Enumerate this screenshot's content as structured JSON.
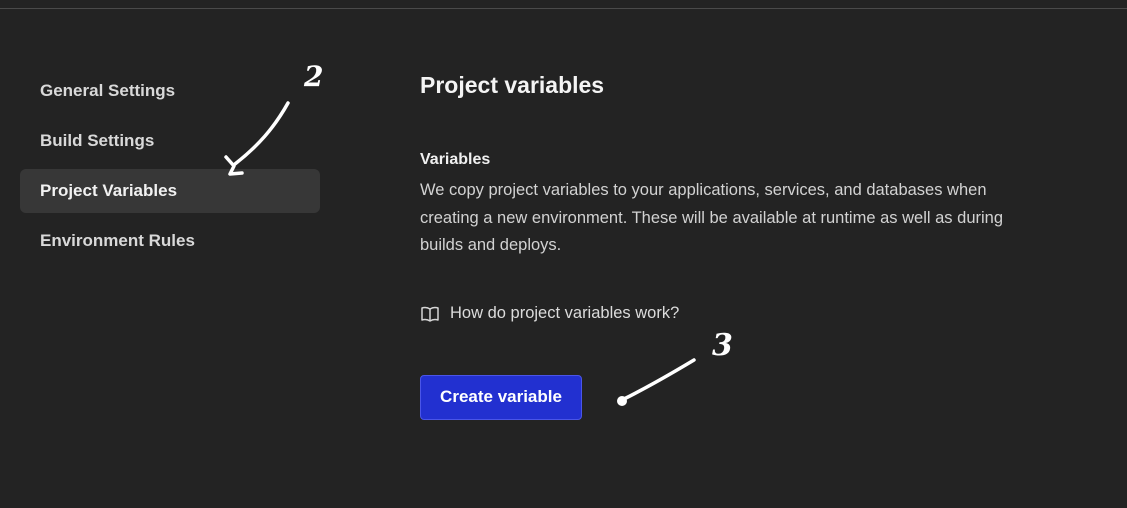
{
  "sidebar": {
    "items": [
      {
        "label": "General Settings"
      },
      {
        "label": "Build Settings"
      },
      {
        "label": "Project Variables",
        "active": true
      },
      {
        "label": "Environment Rules"
      }
    ]
  },
  "main": {
    "title": "Project variables",
    "section_title": "Variables",
    "section_description": "We copy project variables to your applications, services, and databases when creating a new environment. These will be available at runtime as well as during builds and deploys.",
    "help_link_label": "How do project variables work?",
    "help_icon": "book-icon",
    "create_button_label": "Create variable"
  },
  "annotations": {
    "arrow_1_label": "2",
    "arrow_2_label": "3"
  },
  "colors": {
    "background": "#232323",
    "active_nav": "#373737",
    "primary_button": "#2230d0"
  }
}
